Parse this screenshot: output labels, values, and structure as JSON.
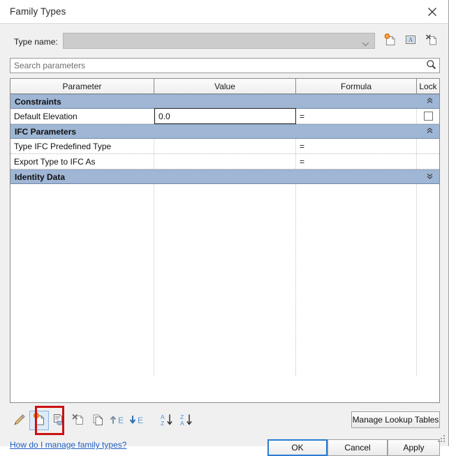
{
  "window": {
    "title": "Family Types",
    "close_icon": "close-icon"
  },
  "type_name": {
    "label": "Type name:",
    "value": "",
    "placeholder": "",
    "dropdown_icon": "chevron-down-icon",
    "actions": [
      {
        "name": "new-type-icon",
        "tooltip": "New Type"
      },
      {
        "name": "rename-type-icon",
        "tooltip": "Rename"
      },
      {
        "name": "delete-type-icon",
        "tooltip": "Delete"
      }
    ]
  },
  "search": {
    "placeholder": "Search parameters",
    "value": "",
    "icon": "search-icon"
  },
  "grid": {
    "columns": [
      {
        "key": "parameter",
        "label": "Parameter"
      },
      {
        "key": "value",
        "label": "Value"
      },
      {
        "key": "formula",
        "label": "Formula"
      },
      {
        "key": "lock",
        "label": "Lock"
      }
    ],
    "groups": [
      {
        "label": "Constraints",
        "collapse_icon": "chevron-up-icon",
        "collapsed": false,
        "rows": [
          {
            "parameter": "Default Elevation",
            "value": "0.0",
            "formula": "=",
            "lock": false,
            "editing": true
          }
        ]
      },
      {
        "label": "IFC Parameters",
        "collapse_icon": "chevron-up-icon",
        "collapsed": false,
        "rows": [
          {
            "parameter": "Type IFC Predefined Type",
            "value": "",
            "formula": "=",
            "lock": null,
            "editing": false
          },
          {
            "parameter": "Export Type to IFC As",
            "value": "",
            "formula": "=",
            "lock": null,
            "editing": false
          }
        ]
      },
      {
        "label": "Identity Data",
        "collapse_icon": "chevron-down-icon",
        "collapsed": true,
        "rows": []
      }
    ]
  },
  "toolbar": {
    "buttons": [
      {
        "name": "edit-parameter-icon",
        "label": "Edit Parameter",
        "selected": false
      },
      {
        "name": "new-parameter-icon",
        "label": "New Parameter",
        "selected": true
      },
      {
        "name": "remove-parameter-icon",
        "label": "Remove Parameter",
        "selected": false
      },
      {
        "name": "delete-parameter-icon",
        "label": "Delete Parameter",
        "selected": false
      },
      {
        "name": "duplicate-parameter-icon",
        "label": "Duplicate Parameter",
        "selected": false
      },
      {
        "name": "move-parameter-up-icon",
        "label": "Move Up",
        "selected": false
      },
      {
        "name": "move-parameter-down-icon",
        "label": "Move Down",
        "selected": false
      },
      {
        "name": "sort-ascending-icon",
        "label": "Sort Ascending",
        "selected": false
      },
      {
        "name": "sort-descending-icon",
        "label": "Sort Descending",
        "selected": false
      }
    ],
    "highlighted_button": "new-parameter-icon",
    "highlight_color": "#cc1111"
  },
  "help": {
    "link_text": "How do I manage family types?"
  },
  "buttons": {
    "manage_lookup_tables": "Manage Lookup Tables",
    "ok": "OK",
    "cancel": "Cancel",
    "apply": "Apply"
  },
  "colors": {
    "group_header": "#9fb6d4",
    "accent_focus": "#2b7cd3",
    "link": "#1f5fbf",
    "selected_tool": "#ddeaf7"
  }
}
